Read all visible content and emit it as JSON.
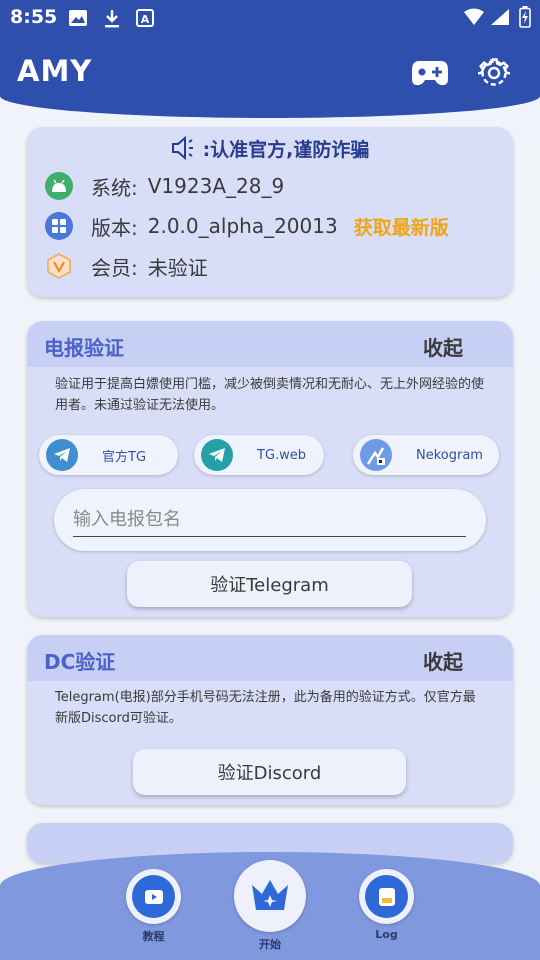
{
  "status_bar": {
    "time": "8:55"
  },
  "app": {
    "title": "AMY"
  },
  "info_card": {
    "notice": ":认准官方,谨防诈骗",
    "system_label": "系统:",
    "system_value": "V1923A_28_9",
    "version_label": "版本:",
    "version_value": "2.0.0_alpha_20013",
    "update_link": "获取最新版",
    "member_label": "会员:",
    "member_value": "未验证"
  },
  "telegram_card": {
    "title": "电报验证",
    "collapse": "收起",
    "description": "验证用于提高白嫖使用门槛，减少被倒卖情况和无耐心、无上外网经验的使用者。未通过验证无法使用。",
    "buttons": [
      {
        "label": "官方TG"
      },
      {
        "label": "TG.web"
      },
      {
        "label": "Nekogram"
      }
    ],
    "input_placeholder": "输入电报包名",
    "verify_label": "验证Telegram"
  },
  "dc_card": {
    "title": "DC验证",
    "collapse": "收起",
    "description": "Telegram(电报)部分手机号码无法注册，此为备用的验证方式。仅官方最新版Discord可验证。",
    "verify_label": "验证Discord"
  },
  "bottom_nav": {
    "tutorial": "教程",
    "start": "开始",
    "log": "Log"
  },
  "colors": {
    "header": "#2f4fad",
    "card": "#d8def8",
    "card_header": "#c7cff5",
    "accent": "#4a63c9",
    "update": "#f0a518",
    "bottom_bar": "#7f98de"
  }
}
